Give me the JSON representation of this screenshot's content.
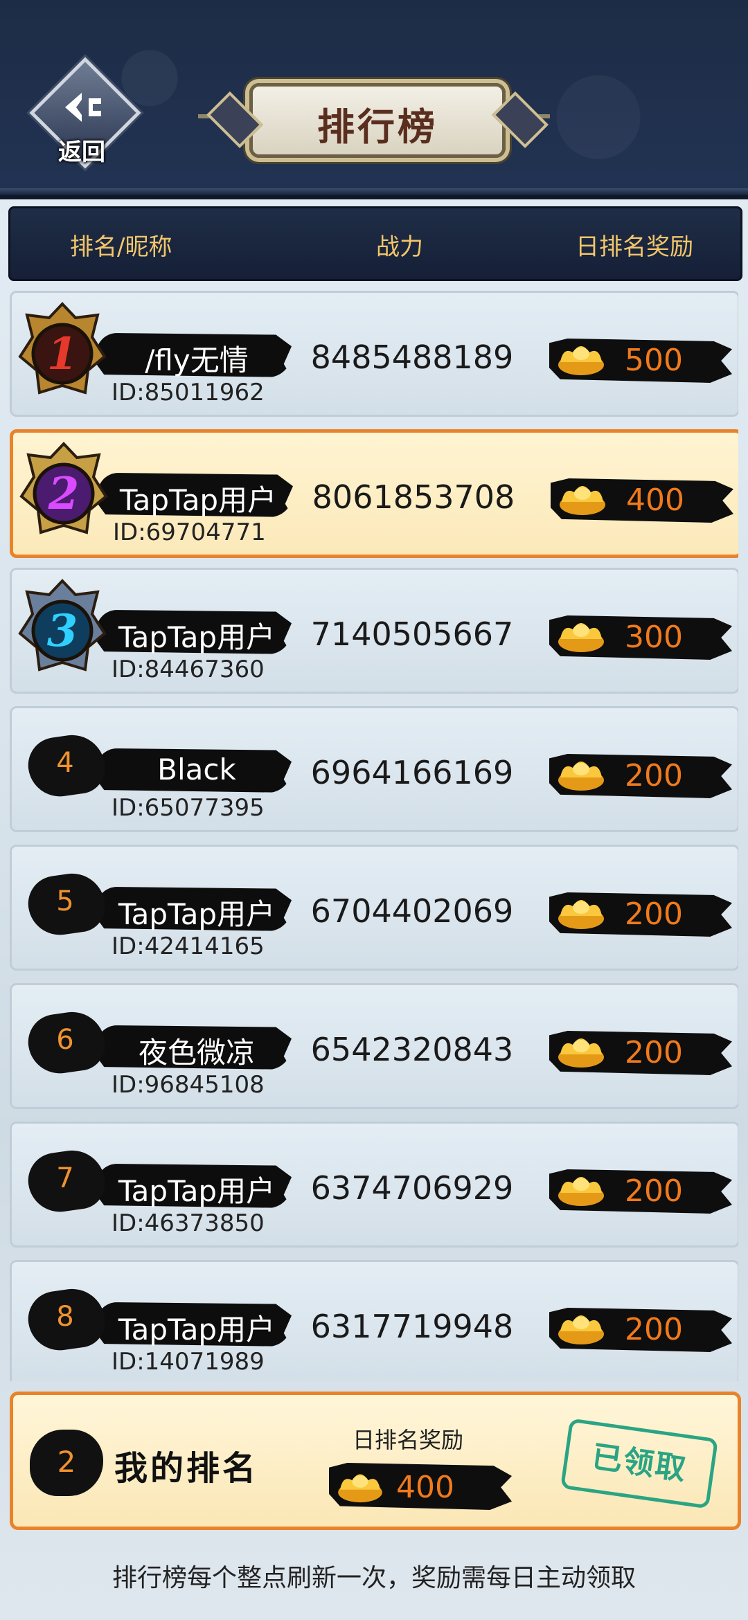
{
  "header": {
    "back_label": "返回",
    "title": "排行榜"
  },
  "columns": {
    "rank_name": "排名/昵称",
    "power": "战力",
    "reward": "日排名奖励"
  },
  "rows": [
    {
      "rank": "1",
      "name": "/fly无情",
      "id": "ID:85011962",
      "power": "8485488189",
      "reward": "500",
      "badge": "gold-crest",
      "highlight": false
    },
    {
      "rank": "2",
      "name": "TapTap用户",
      "id": "ID:69704771",
      "power": "8061853708",
      "reward": "400",
      "badge": "purple-crest",
      "highlight": true
    },
    {
      "rank": "3",
      "name": "TapTap用户",
      "id": "ID:84467360",
      "power": "7140505667",
      "reward": "300",
      "badge": "blue-crest",
      "highlight": false
    },
    {
      "rank": "4",
      "name": "Black",
      "id": "ID:65077395",
      "power": "6964166169",
      "reward": "200",
      "highlight": false
    },
    {
      "rank": "5",
      "name": "TapTap用户",
      "id": "ID:42414165",
      "power": "6704402069",
      "reward": "200",
      "highlight": false
    },
    {
      "rank": "6",
      "name": "夜色微凉",
      "id": "ID:96845108",
      "power": "6542320843",
      "reward": "200",
      "highlight": false
    },
    {
      "rank": "7",
      "name": "TapTap用户",
      "id": "ID:46373850",
      "power": "6374706929",
      "reward": "200",
      "highlight": false
    },
    {
      "rank": "8",
      "name": "TapTap用户",
      "id": "ID:14071989",
      "power": "6317719948",
      "reward": "200",
      "highlight": false
    }
  ],
  "my_rank": {
    "rank": "2",
    "label": "我的排名",
    "reward_title": "日排名奖励",
    "reward": "400",
    "status": "已领取"
  },
  "footer_note": "排行榜每个整点刷新一次，奖励需每日主动领取",
  "colors": {
    "header_bg": "#1d2c46",
    "accent_orange": "#e9832a",
    "reward_text": "#f07a1c",
    "column_gold": "#f3c66a",
    "stamp_green": "#2aa483"
  }
}
